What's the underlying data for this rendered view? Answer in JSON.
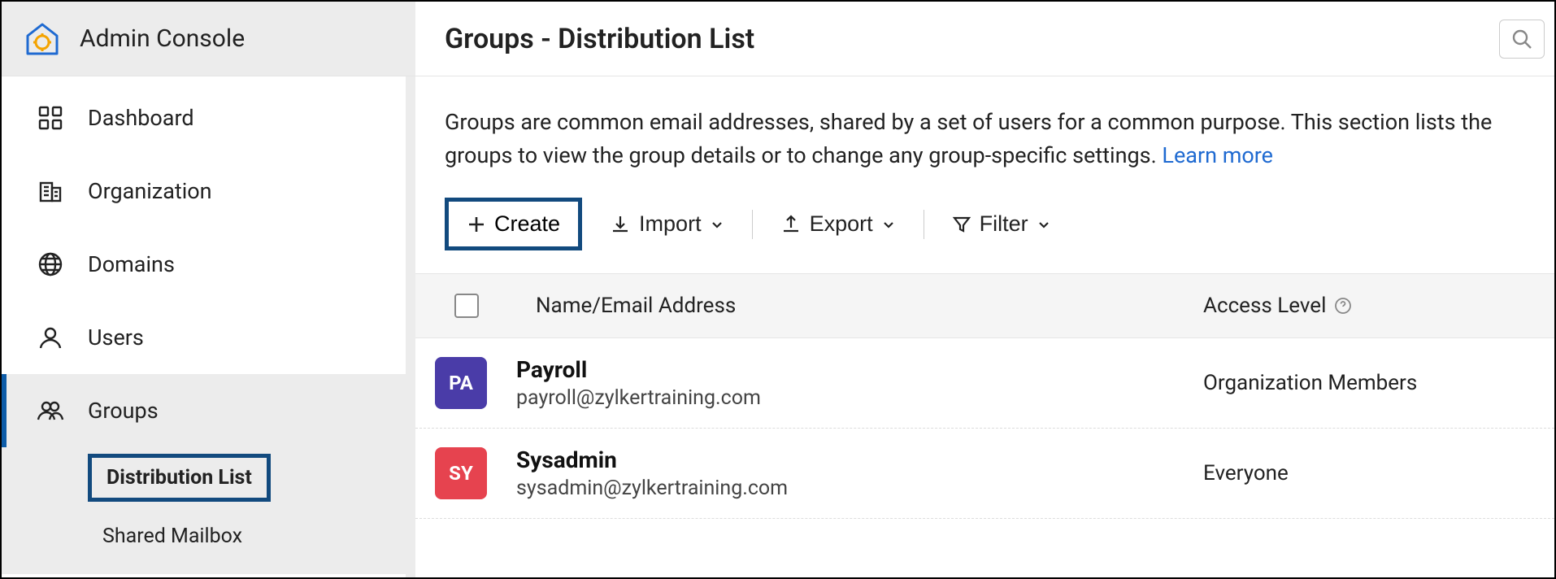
{
  "sidebar": {
    "title": "Admin Console",
    "items": [
      {
        "label": "Dashboard"
      },
      {
        "label": "Organization"
      },
      {
        "label": "Domains"
      },
      {
        "label": "Users"
      },
      {
        "label": "Groups",
        "active": true,
        "sub": [
          {
            "label": "Distribution List",
            "highlighted": true
          },
          {
            "label": "Shared Mailbox"
          }
        ]
      }
    ]
  },
  "header": {
    "title": "Groups - Distribution List"
  },
  "description": {
    "text": "Groups are common email addresses, shared by a set of users for a common purpose. This section lists the groups to view the group details or to change any group-specific settings.  ",
    "learn_more": "Learn more"
  },
  "toolbar": {
    "create_label": "Create",
    "import_label": "Import",
    "export_label": "Export",
    "filter_label": "Filter"
  },
  "table": {
    "headers": {
      "name": "Name/Email Address",
      "access": "Access Level"
    },
    "rows": [
      {
        "initials": "PA",
        "name": "Payroll",
        "email": "payroll@zylkertraining.com",
        "access": "Organization Members",
        "color": "#4a3ca8"
      },
      {
        "initials": "SY",
        "name": "Sysadmin",
        "email": "sysadmin@zylkertraining.com",
        "access": "Everyone",
        "color": "#e6434f"
      }
    ]
  }
}
